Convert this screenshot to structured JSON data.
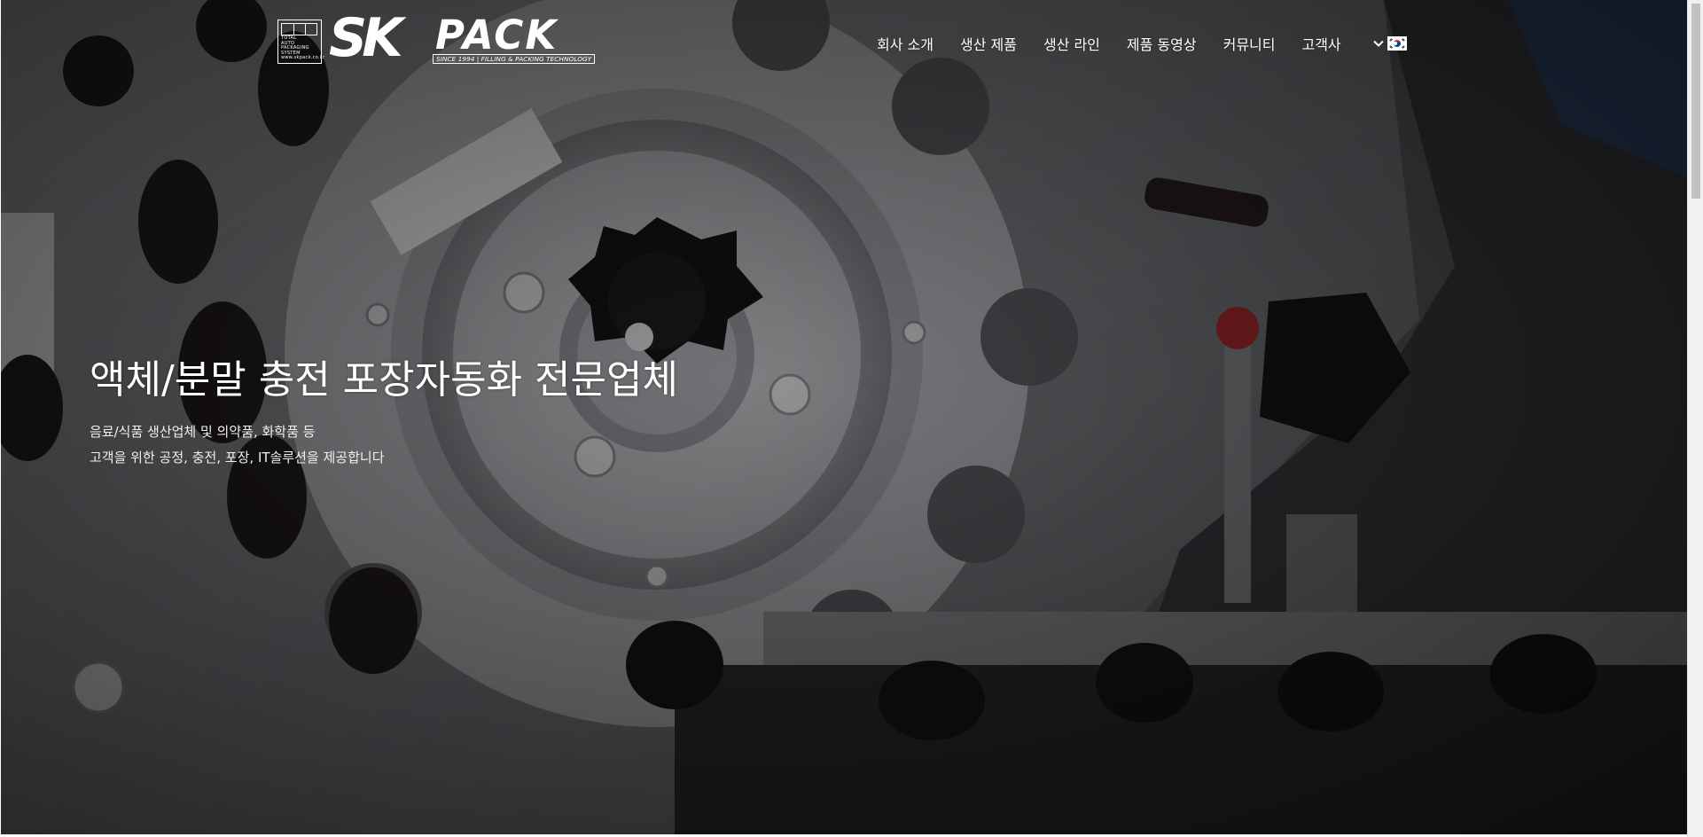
{
  "logo": {
    "box_text": "TOTAL\nAUTO\nPACKAGING\nSYSTEM\nwww.skpack.co.kr",
    "brand_sk": "SK",
    "brand_pack": "PACK",
    "tagline": "SINCE 1994 | FILLING & PACKING TECHNOLOGY"
  },
  "nav": {
    "items": [
      {
        "label": "회사 소개"
      },
      {
        "label": "생산 제품"
      },
      {
        "label": "생산 라인"
      },
      {
        "label": "제품 동영상"
      },
      {
        "label": "커뮤니티"
      },
      {
        "label": "고객사"
      }
    ],
    "language_icon": "chevron-down-icon",
    "flag_icon": "korea-flag-icon"
  },
  "hero": {
    "title": "액체/분말 충전 포장자동화 전문업체",
    "subtitle_line1": "음료/식품 생산업체 및 의약품, 화학품 등",
    "subtitle_line2": "고객을 위한 공정, 충전, 포장, IT솔루션을 제공합니다"
  },
  "colors": {
    "text": "#ffffff",
    "overlay": "#3a3a3d",
    "flag_red": "#cd2e3a",
    "flag_blue": "#0047a0"
  }
}
